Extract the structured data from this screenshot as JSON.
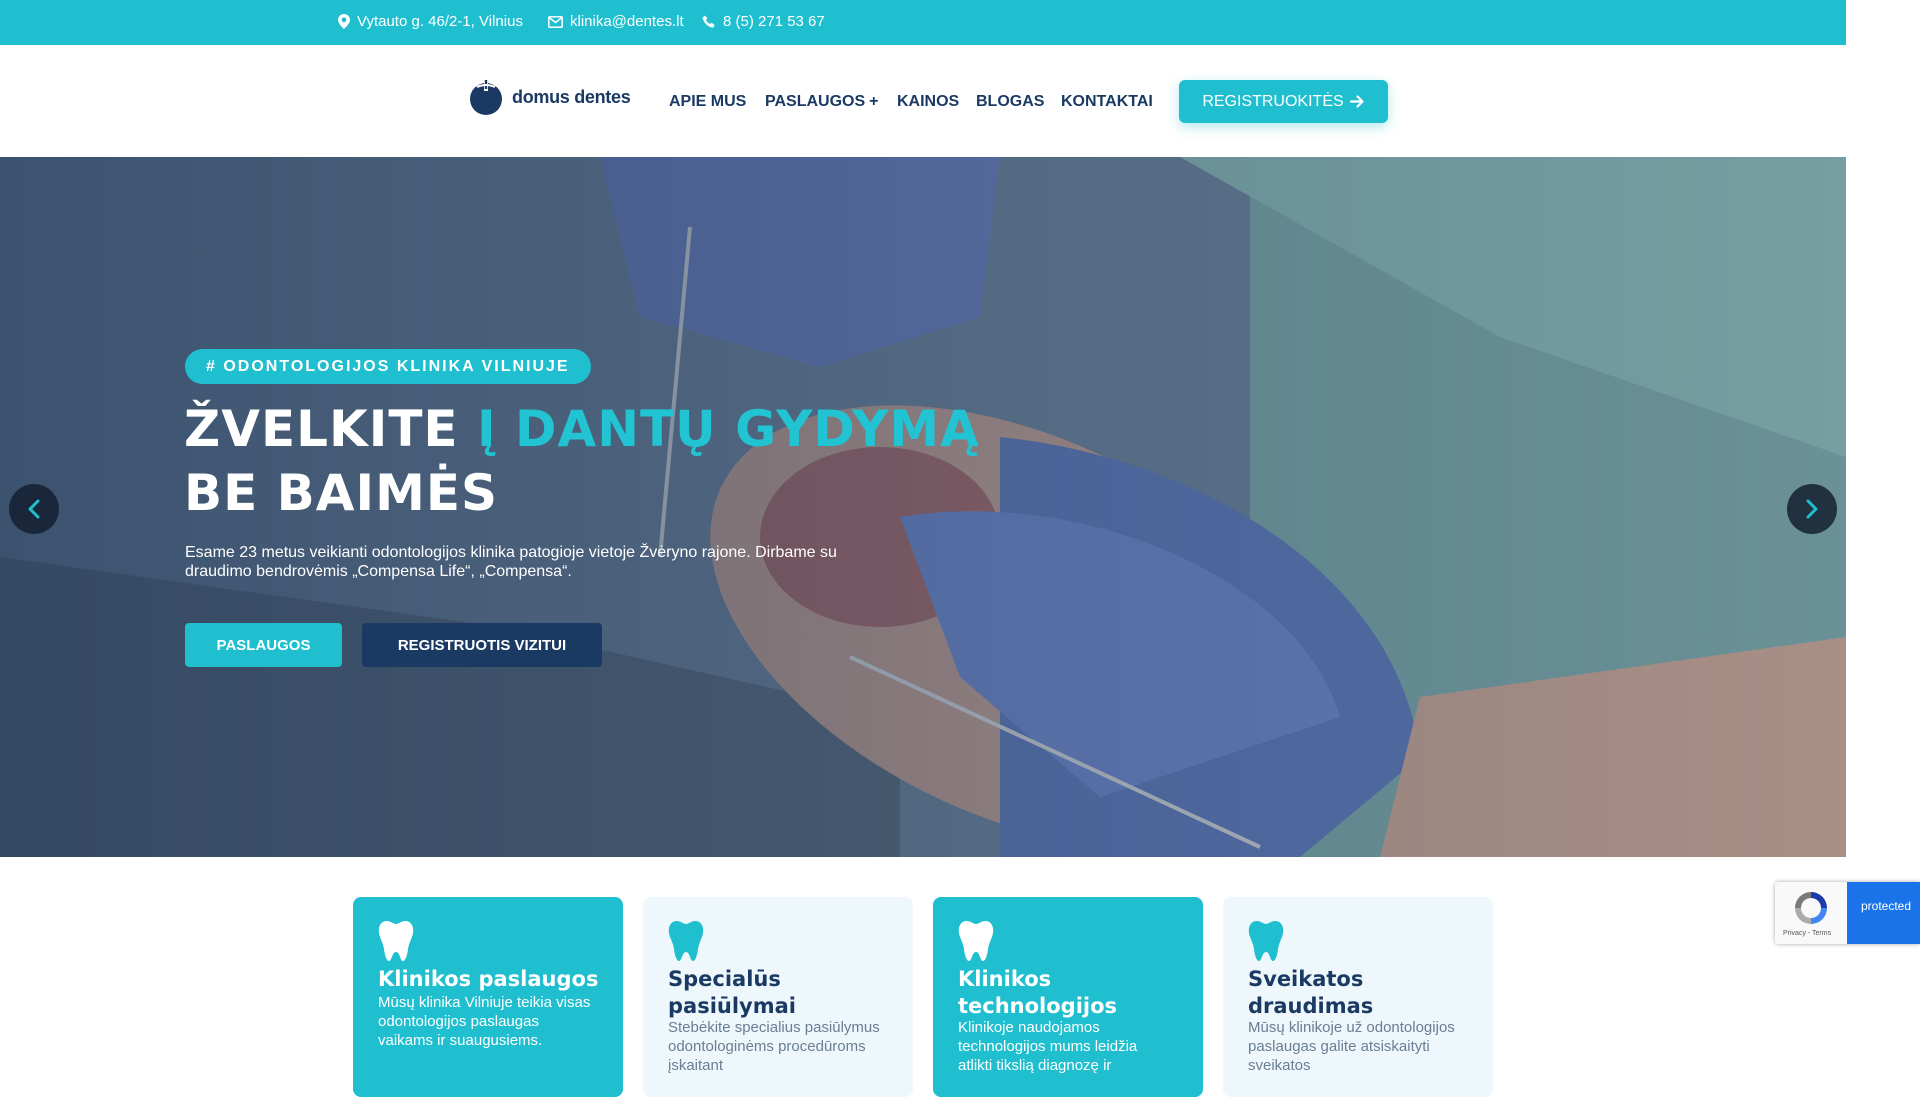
{
  "topbar": {
    "address": "Vytauto g. 46/2-1, Vilnius",
    "email": "klinika@dentes.lt",
    "phone": "8 (5) 271 53 67"
  },
  "brand": {
    "name": "domus dentes"
  },
  "nav": {
    "items": [
      "APIE MUS",
      "PASLAUGOS",
      "KAINOS",
      "BLOGAS",
      "KONTAKTAI"
    ],
    "register_button": "REGISTRUOKITĖS"
  },
  "hero": {
    "tag": "# ODONTOLOGIJOS KLINIKA VILNIUJE",
    "title_part1": "ŽVELKITE ",
    "title_accent": "Į DANTŲ GYDYMĄ",
    "title_part2": "BE BAIMĖS",
    "description": "Esame 23 metus veikianti odontologijos klinika patogioje vietoje Žvėryno rajone. Dirbame su draudimo bendrovėmis „Compensa Life“, „Compensa“.",
    "button_primary": "PASLAUGOS",
    "button_secondary": "REGISTRUOTIS VIZITUI"
  },
  "cards": [
    {
      "title": "Klinikos paslaugos",
      "text": "Mūsų klinika Vilniuje teikia visas odontologijos paslaugas vaikams ir suaugusiems."
    },
    {
      "title": "Specialūs pasiūlymai",
      "text": "Stebėkite specialius pasiūlymus odontologinėms procedūroms įskaitant"
    },
    {
      "title": "Klinikos technologijos",
      "text": "Klinikoje naudojamos technologijos mums leidžia atlikti tikslią diagnozę ir"
    },
    {
      "title": "Sveikatos draudimas",
      "text": "Mūsų klinikoje už odontologijos paslaugas galite atsiskaityti sveikatos"
    }
  ],
  "recaptcha": {
    "label": "protected",
    "terms": "Privacy - Terms"
  },
  "colors": {
    "accent": "#1fbfcf",
    "navy": "#1b3a63",
    "light_card": "#eef7fb"
  }
}
